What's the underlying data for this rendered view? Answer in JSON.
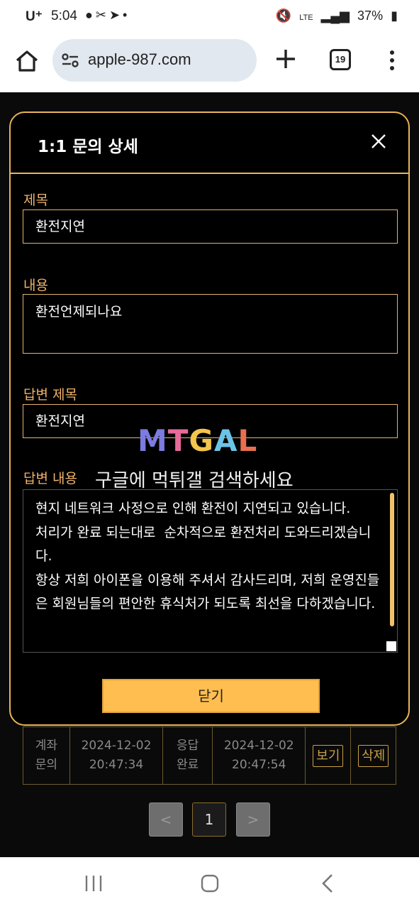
{
  "status_bar": {
    "carrier": "U⁺",
    "time": "5:04",
    "battery": "37%",
    "network": "LTE"
  },
  "browser": {
    "url": "apple-987.com",
    "tab_count": "19"
  },
  "modal": {
    "title": "1:1 문의 상세",
    "subject_label": "제목",
    "subject_value": "환전지연",
    "content_label": "내용",
    "content_value": "환전언제되나요",
    "answer_subject_label": "답변 제목",
    "answer_subject_value": "환전지연",
    "answer_content_label": "답변 내용",
    "answer_content_value": "현지 네트워크 사정으로 인해 환전이 지연되고 있습니다.\n처리가 완료 되는대로  순차적으로 환전처리 도와드리겠습니다.\n항상 저희 아이폰을 이용해 주셔서 감사드리며, 저희 운영진들은 회원님들의 편안한 휴식처가 되도록 최선을 다하겠습니다.",
    "close_button": "닫기"
  },
  "watermark": {
    "logo": [
      "M",
      "T",
      "G",
      "A",
      "L"
    ],
    "text": "구글에 먹튀갤 검색하세요"
  },
  "bg_table": {
    "row": {
      "type_line1": "계좌",
      "type_line2": "문의",
      "date1_line1": "2024-12-02",
      "date1_line2": "20:47:34",
      "status_line1": "응답",
      "status_line2": "완료",
      "date2_line1": "2024-12-02",
      "date2_line2": "20:47:54",
      "view_button": "보기",
      "delete_button": "삭제"
    }
  },
  "pagination": {
    "prev": "<",
    "current": "1",
    "next": ">"
  },
  "colors": {
    "accent": "#e8b35a",
    "label": "#f0b26a",
    "button": "#ffbe4f"
  }
}
